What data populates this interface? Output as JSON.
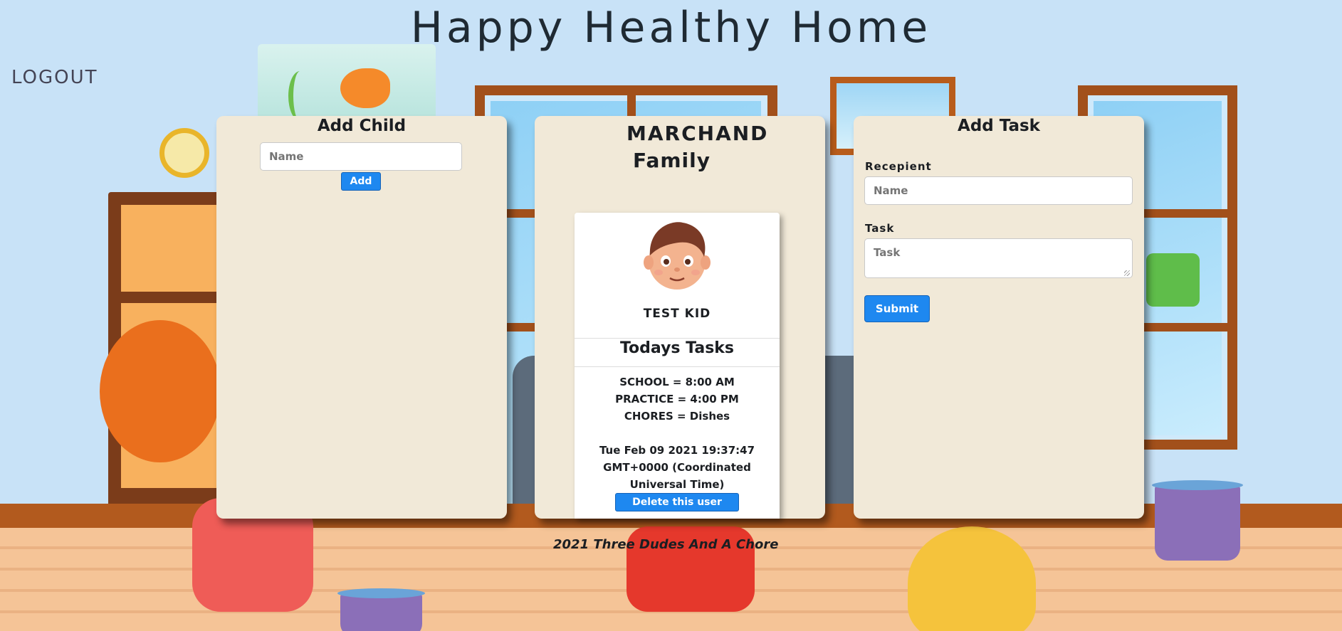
{
  "header": {
    "title": "Happy Healthy Home",
    "logout_label": "LOGOUT"
  },
  "add_child": {
    "title": "Add Child",
    "name_placeholder": "Name",
    "add_label": "Add"
  },
  "family": {
    "name_line1": "MARCHAND",
    "name_line2": "Family",
    "child": {
      "name": "TEST KID",
      "tasks_title": "Todays Tasks",
      "tasks": [
        "SCHOOL = 8:00 AM",
        "PRACTICE = 4:00 PM",
        "CHORES = Dishes"
      ],
      "date_line1": "Tue Feb 09 2021 19:37:47",
      "date_line2": "GMT+0000 (Coordinated",
      "date_line3": "Universal Time)",
      "delete_label": "Delete this user"
    }
  },
  "add_task": {
    "title": "Add Task",
    "recipient_label": "Recepient",
    "recipient_placeholder": "Name",
    "task_label": "Task",
    "task_placeholder": "Task",
    "submit_label": "Submit"
  },
  "footer": {
    "text": "2021 Three Dudes And A Chore"
  },
  "colors": {
    "panel_bg": "#f1e9d8",
    "button_blue": "#1e88f0",
    "wall": "#c8e2f7"
  }
}
